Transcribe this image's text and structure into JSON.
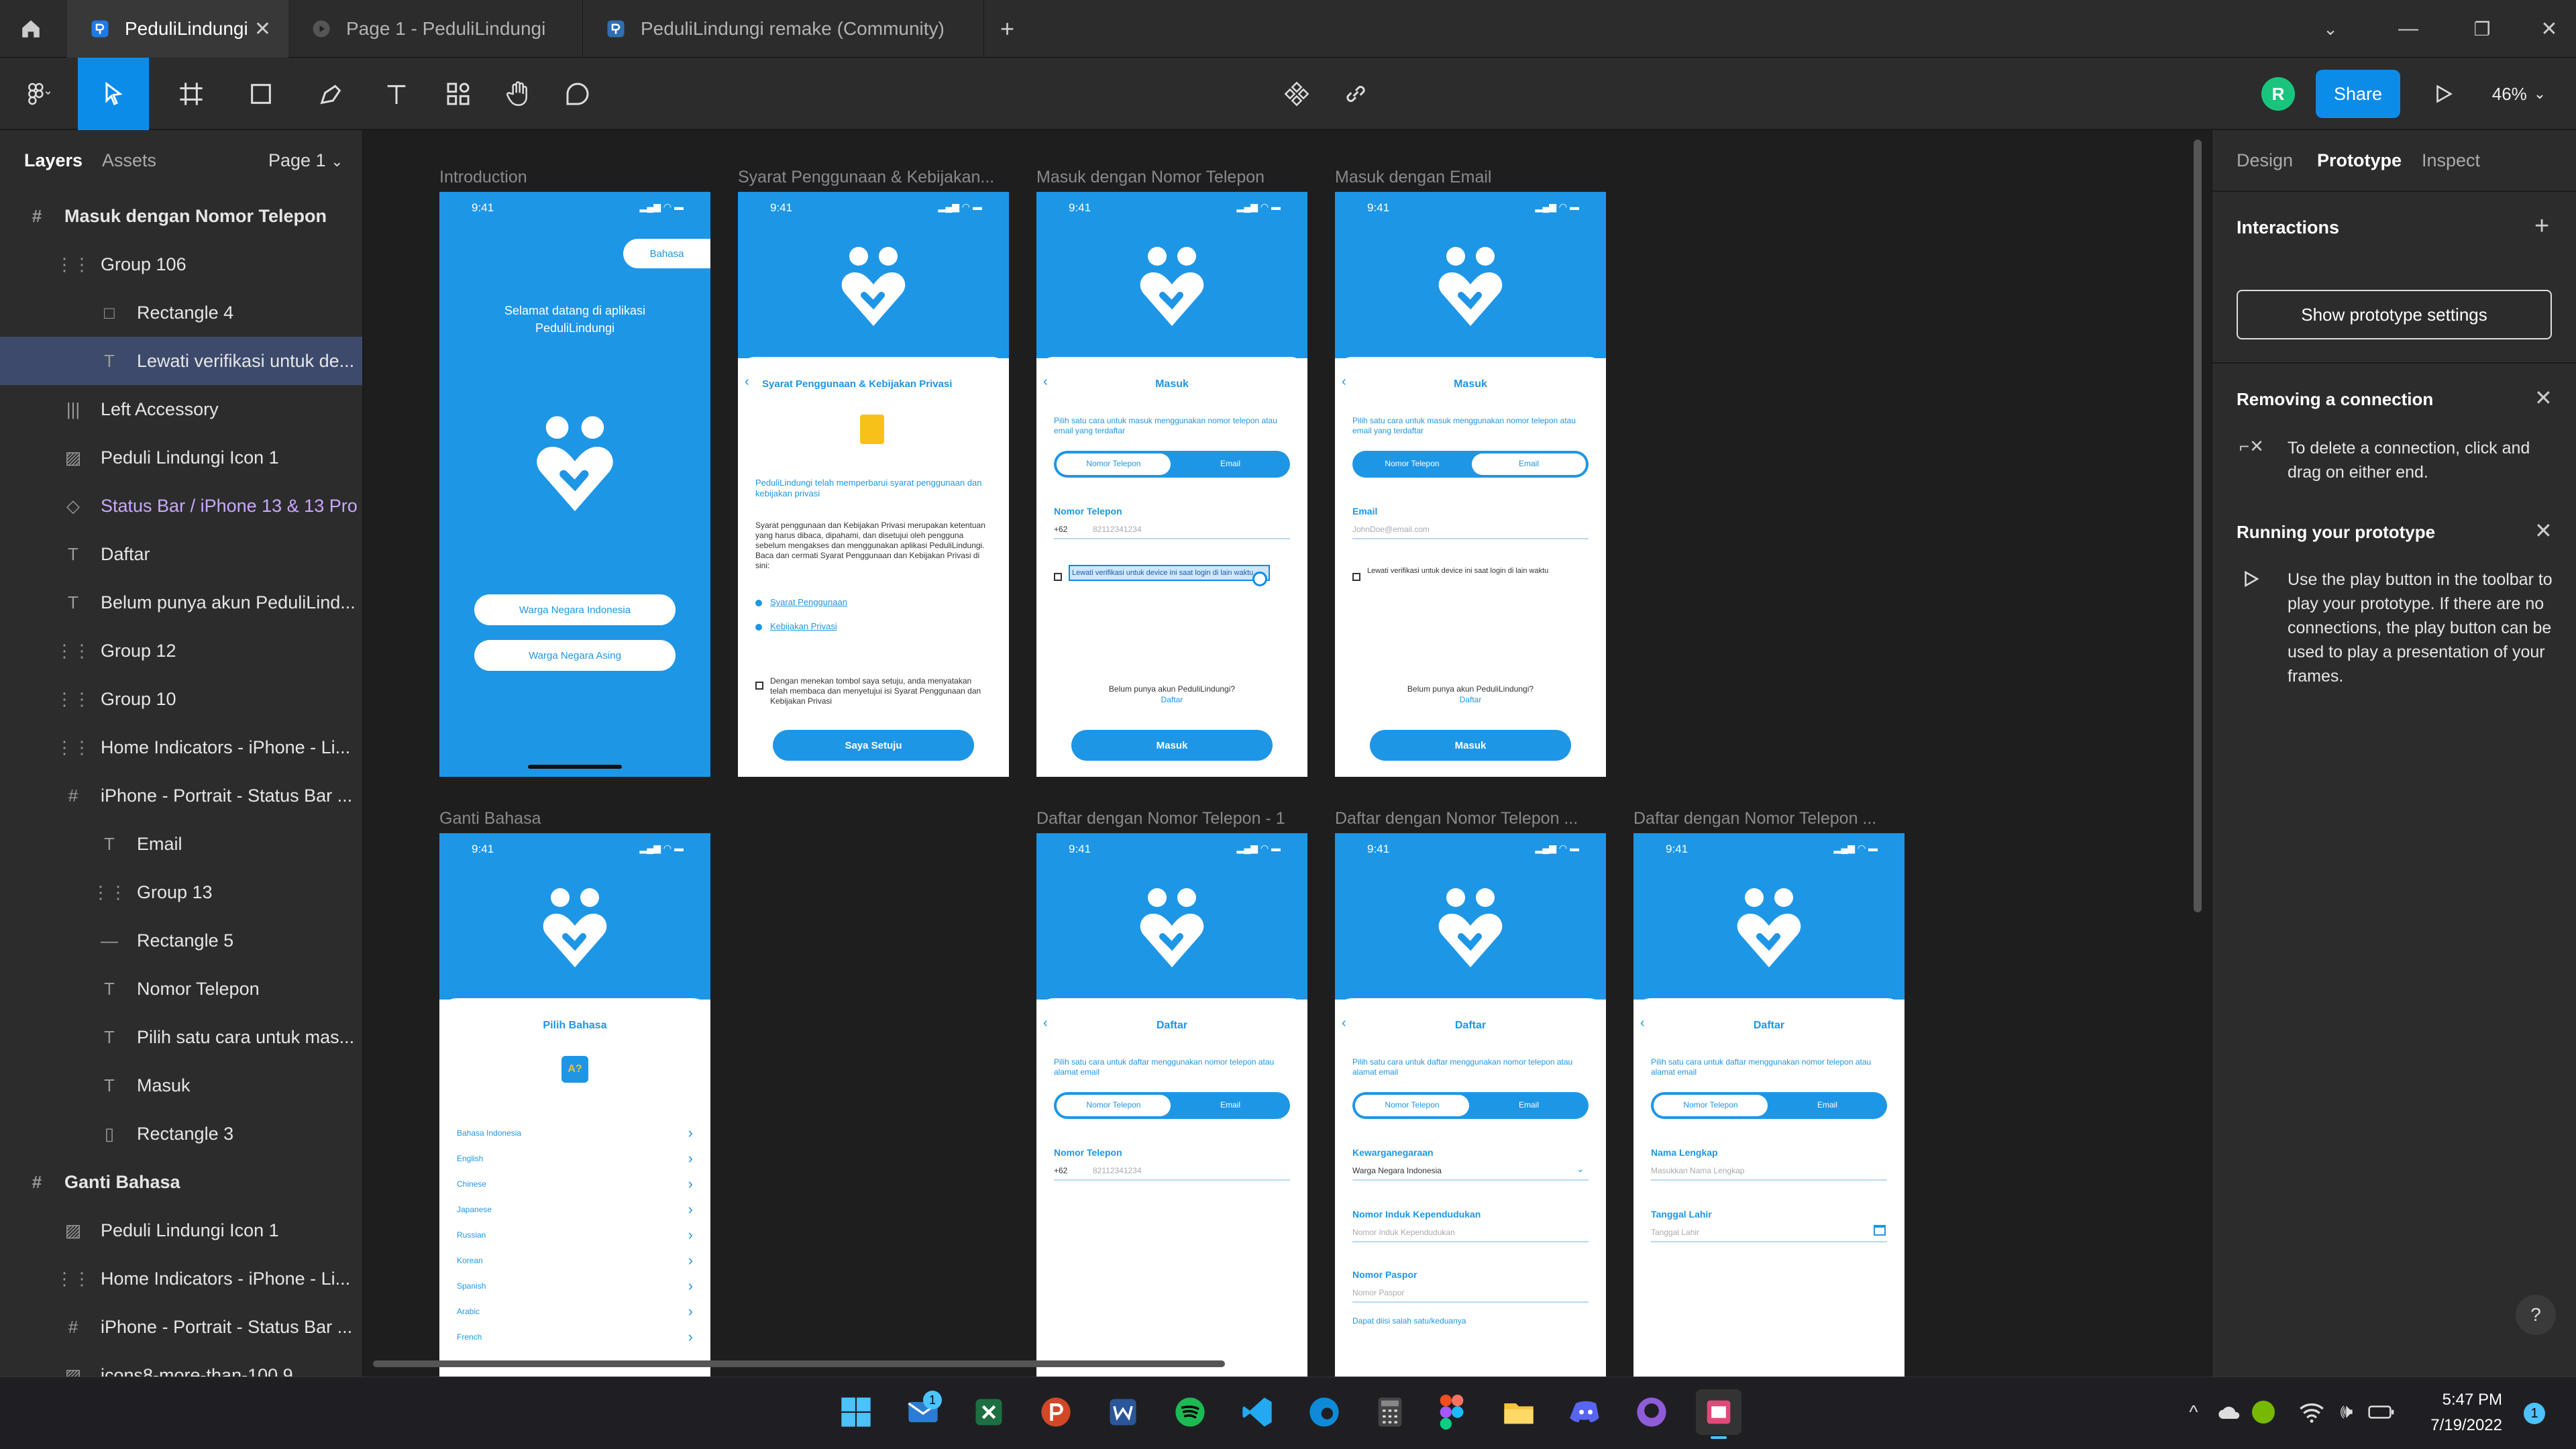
{
  "tabs": [
    {
      "label": "PeduliLindungi"
    },
    {
      "label": "Page 1 - PeduliLindungi"
    },
    {
      "label": "PeduliLindungi remake (Community)"
    }
  ],
  "toolbar": {
    "share": "Share",
    "zoom": "46%",
    "avatar": "R"
  },
  "left": {
    "layers_tab": "Layers",
    "assets_tab": "Assets",
    "page": "Page 1",
    "layers": [
      {
        "label": "Masuk dengan Nomor Telepon",
        "icon": "#"
      },
      {
        "label": "Group 106",
        "icon": "⋮⋮"
      },
      {
        "label": "Rectangle 4",
        "icon": "□"
      },
      {
        "label": "Lewati verifikasi untuk de...",
        "icon": "T"
      },
      {
        "label": "Left Accessory",
        "icon": "|||"
      },
      {
        "label": "Peduli Lindungi Icon 1",
        "icon": "▨"
      },
      {
        "label": "Status Bar / iPhone 13 & 13 Pro",
        "icon": "◇"
      },
      {
        "label": "Daftar",
        "icon": "T"
      },
      {
        "label": "Belum punya akun PeduliLind...",
        "icon": "T"
      },
      {
        "label": "Group 12",
        "icon": "⋮⋮"
      },
      {
        "label": "Group 10",
        "icon": "⋮⋮"
      },
      {
        "label": "Home Indicators - iPhone - Li...",
        "icon": "⋮⋮"
      },
      {
        "label": "iPhone - Portrait - Status Bar ...",
        "icon": "#"
      },
      {
        "label": "Email",
        "icon": "T"
      },
      {
        "label": "Group 13",
        "icon": "⋮⋮"
      },
      {
        "label": "Rectangle 5",
        "icon": "—"
      },
      {
        "label": "Nomor Telepon",
        "icon": "T"
      },
      {
        "label": "Pilih satu cara untuk mas...",
        "icon": "T"
      },
      {
        "label": "Masuk",
        "icon": "T"
      },
      {
        "label": "Rectangle 3",
        "icon": "▯"
      },
      {
        "label": "Ganti Bahasa",
        "icon": "#"
      },
      {
        "label": "Peduli Lindungi Icon 1",
        "icon": "▨"
      },
      {
        "label": "Home Indicators - iPhone - Li...",
        "icon": "⋮⋮"
      },
      {
        "label": "iPhone - Portrait - Status Bar ...",
        "icon": "#"
      },
      {
        "label": "icons8-more-than-100 9",
        "icon": "▨"
      }
    ]
  },
  "right": {
    "tabs": [
      "Design",
      "Prototype",
      "Inspect"
    ],
    "interactions": "Interactions",
    "show_settings": "Show prototype settings",
    "removing_title": "Removing a connection",
    "removing_text": "To delete a connection, click and drag on either end.",
    "running_title": "Running your prototype",
    "running_text": "Use the play button in the toolbar to play your prototype. If there are no connections, the play button can be used to play a presentation of your frames.",
    "help": "?"
  },
  "frames": {
    "labels": [
      "Introduction",
      "Syarat Penggunaan & Kebijakan...",
      "Masuk dengan Nomor Telepon",
      "Masuk dengan Email",
      "Ganti Bahasa",
      "Daftar dengan Nomor Telepon - 1",
      "Daftar dengan Nomor Telepon ...",
      "Daftar dengan Nomor Telepon ..."
    ],
    "time": "9:41",
    "intro": {
      "bahasa": "Bahasa",
      "welcome": "Selamat datang di aplikasi PeduliLindungi",
      "btn1": "Warga Negara Indonesia",
      "btn2": "Warga Negara Asing"
    },
    "syarat": {
      "title": "Syarat Penggunaan & Kebijakan Privasi",
      "updated": "PeduliLindungi telah memperbarui syarat penggunaan dan kebijakan privasi",
      "body": "Syarat penggunaan dan Kebijakan Privasi merupakan ketentuan yang harus dibaca, dipahami, dan disetujui oleh pengguna sebelum mengakses dan menggunakan aplikasi PeduliLindungi. Baca dan cermati Syarat Penggunaan dan Kebijakan Privasi di sini:",
      "link1": "Syarat Penggunaan",
      "link2": "Kebijakan Privasi",
      "agree_text": "Dengan menekan tombol saya setuju, anda menyatakan telah membaca dan menyetujui isi Syarat Penggunaan dan Kebijakan Privasi",
      "btn": "Saya Setuju"
    },
    "masuk": {
      "title": "Masuk",
      "subtitle": "Pilih satu cara untuk masuk menggunakan nomor telepon atau email yang terdaftar",
      "seg_phone": "Nomor Telepon",
      "seg_email": "Email",
      "phone_label": "Nomor Telepon",
      "phone_code": "+62",
      "phone_ph": "82112341234",
      "skip": "Lewati verifikasi untuk device ini saat login di lain waktu",
      "no_account": "Belum punya akun PeduliLindungi?",
      "daftar": "Daftar",
      "btn": "Masuk",
      "email_label": "Email",
      "email_ph": "JohnDoe@email.com"
    },
    "bahasa": {
      "title": "Pilih Bahasa",
      "langs": [
        "Bahasa Indonesia",
        "English",
        "Chinese",
        "Japanese",
        "Russian",
        "Korean",
        "Spanish",
        "Arabic",
        "French"
      ]
    },
    "daftar": {
      "title": "Daftar",
      "subtitle": "Pilih satu cara untuk daftar menggunakan nomor telepon atau alamat email",
      "kew_label": "Kewarganegaraan",
      "kew_val": "Warga Negara Indonesia",
      "nik_label": "Nomor Induk Kependudukan",
      "nik_ph": "Nomor Induk Kependudukan",
      "paspor_label": "Nomor Paspor",
      "paspor_ph": "Nomor Paspor",
      "either": "Dapat diisi salah satu/keduanya",
      "nama_label": "Nama Lengkap",
      "nama_ph": "Masukkan Nama Lengkap",
      "tgl_label": "Tanggal Lahir",
      "tgl_ph": "Tanggal Lahir"
    }
  },
  "taskbar": {
    "time": "5:47 PM",
    "date": "7/19/2022",
    "mail_badge": "1",
    "notif": "1"
  },
  "colors": {
    "brand": "#1e96e6",
    "accent": "#0c8ce9",
    "selected": "#3d4a6b"
  }
}
